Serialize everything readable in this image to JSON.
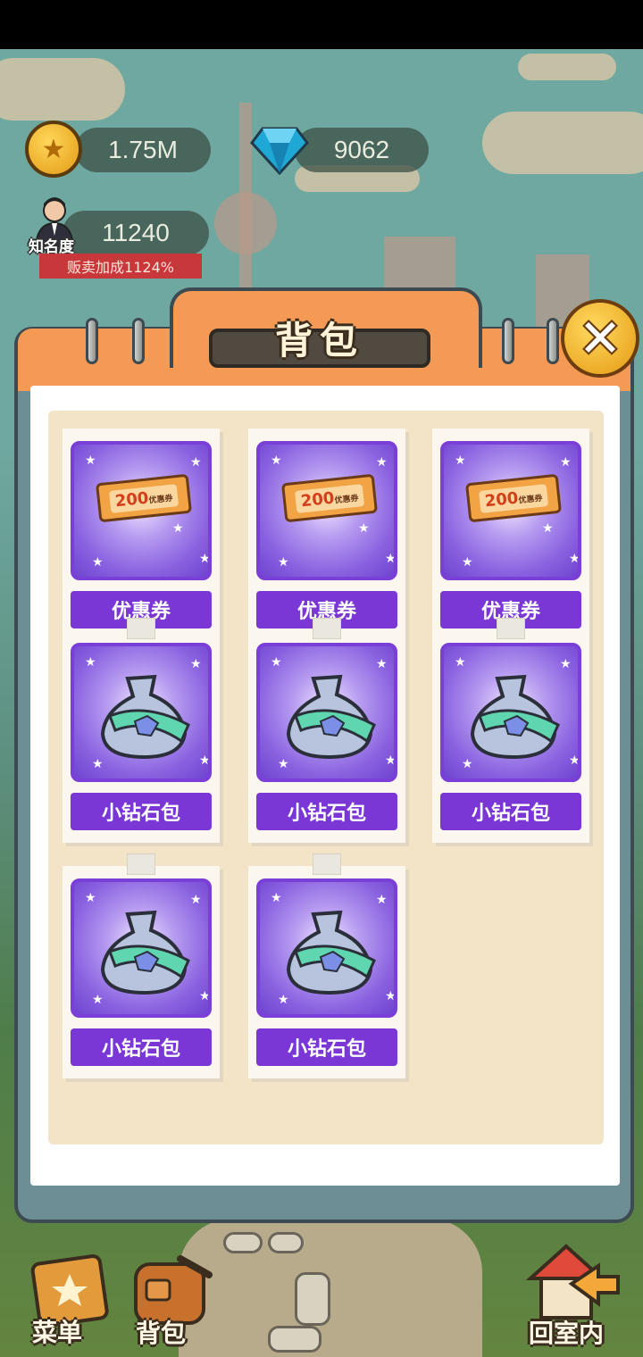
{
  "hud": {
    "coins": "1.75M",
    "diamonds": "9062",
    "fame_value": "11240",
    "fame_label": "知名度",
    "sale_bonus": "贩卖加成1124%"
  },
  "panel": {
    "title": "背包",
    "close_icon": "close-icon"
  },
  "inventory": [
    {
      "label": "优惠券",
      "icon": "coupon-icon",
      "ticket_value": "200",
      "ticket_text": "优惠券"
    },
    {
      "label": "优惠券",
      "icon": "coupon-icon",
      "ticket_value": "200",
      "ticket_text": "优惠券"
    },
    {
      "label": "优惠券",
      "icon": "coupon-icon",
      "ticket_value": "200",
      "ticket_text": "优惠券"
    },
    {
      "label": "小钻石包",
      "icon": "diamond-bag-icon"
    },
    {
      "label": "小钻石包",
      "icon": "diamond-bag-icon"
    },
    {
      "label": "小钻石包",
      "icon": "diamond-bag-icon"
    },
    {
      "label": "小钻石包",
      "icon": "diamond-bag-icon"
    },
    {
      "label": "小钻石包",
      "icon": "diamond-bag-icon"
    }
  ],
  "nav": {
    "menu": "菜单",
    "backpack": "背包",
    "go_indoor": "回室内"
  },
  "colors": {
    "panel_orange": "#f49a55",
    "item_purple": "#7b36d6",
    "paper_bg": "#f3e4c7"
  }
}
